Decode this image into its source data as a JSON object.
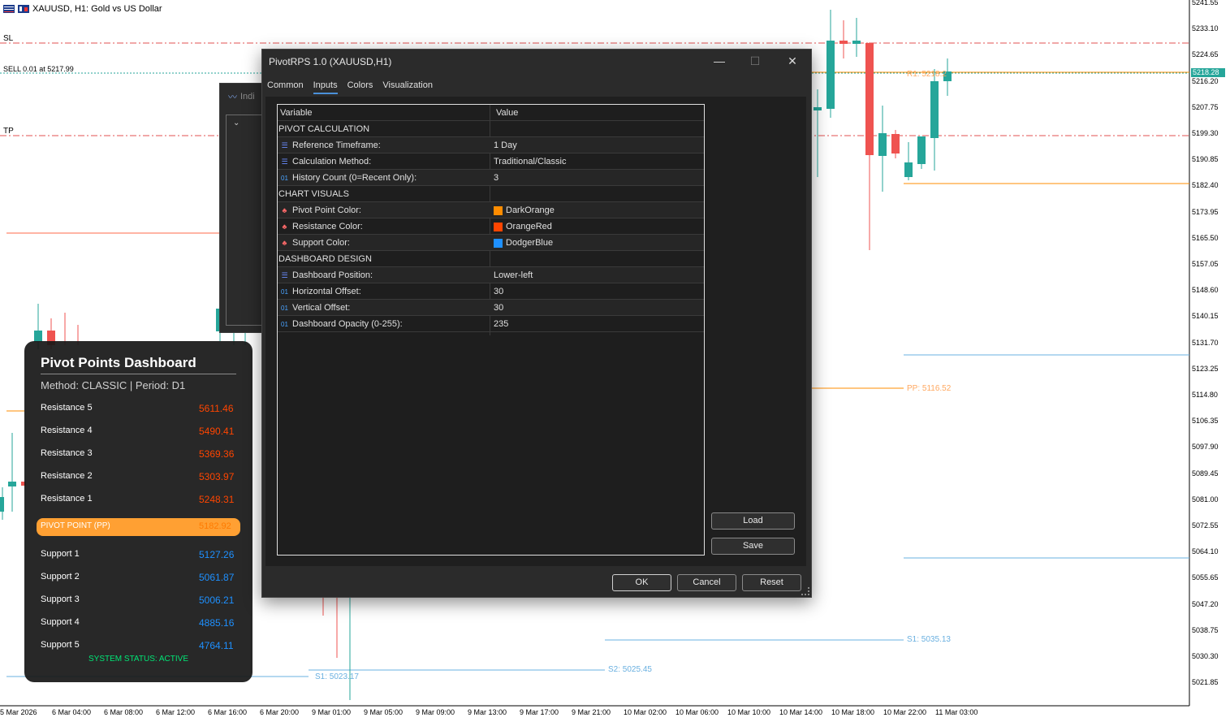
{
  "chart": {
    "symbol_title": "XAUUSD, H1:  Gold vs US Dollar",
    "lines": {
      "sl": "SL",
      "sell": "SELL 0.01 at 5217.99",
      "tp": "TP"
    },
    "current_price": "5218.28",
    "levels": {
      "r1": "R1: 5218.2",
      "pp": "PP: 5116.52",
      "s1_right": "S1: 5035.13",
      "s2": "S2: 5025.45",
      "s1_left": "S1: 5023.17"
    },
    "price_axis": [
      "5241.55",
      "5233.10",
      "5224.65",
      "5216.20",
      "5207.75",
      "5199.30",
      "5190.85",
      "5182.40",
      "5173.95",
      "5165.50",
      "5157.05",
      "5148.60",
      "5140.15",
      "5131.70",
      "5123.25",
      "5114.80",
      "5106.35",
      "5097.90",
      "5089.45",
      "5081.00",
      "5072.55",
      "5064.10",
      "5055.65",
      "5047.20",
      "5038.75",
      "5030.30",
      "5021.85"
    ],
    "time_axis": [
      "5 Mar 2026",
      "6 Mar 04:00",
      "6 Mar 08:00",
      "6 Mar 12:00",
      "6 Mar 16:00",
      "6 Mar 20:00",
      "9 Mar 01:00",
      "9 Mar 05:00",
      "9 Mar 09:00",
      "9 Mar 13:00",
      "9 Mar 17:00",
      "9 Mar 21:00",
      "10 Mar 02:00",
      "10 Mar 06:00",
      "10 Mar 10:00",
      "10 Mar 14:00",
      "10 Mar 18:00",
      "10 Mar 22:00",
      "11 Mar 03:00"
    ]
  },
  "behind_window": {
    "title": "Indi"
  },
  "dashboard": {
    "title": "Pivot Points Dashboard",
    "method": "Method: CLASSIC | Period: D1",
    "resistance": [
      {
        "label": "Resistance 5",
        "value": "5611.46"
      },
      {
        "label": "Resistance 4",
        "value": "5490.41"
      },
      {
        "label": "Resistance 3",
        "value": "5369.36"
      },
      {
        "label": "Resistance 2",
        "value": "5303.97"
      },
      {
        "label": "Resistance 1",
        "value": "5248.31"
      }
    ],
    "pivot": {
      "label": "PIVOT POINT (PP)",
      "value": "5182.92"
    },
    "support": [
      {
        "label": "Support 1",
        "value": "5127.26"
      },
      {
        "label": "Support 2",
        "value": "5061.87"
      },
      {
        "label": "Support 3",
        "value": "5006.21"
      },
      {
        "label": "Support 4",
        "value": "4885.16"
      },
      {
        "label": "Support 5",
        "value": "4764.11"
      }
    ],
    "status": "SYSTEM STATUS: ACTIVE"
  },
  "dialog": {
    "title": "PivotRPS 1.0 (XAUUSD,H1)",
    "tabs": [
      "Common",
      "Inputs",
      "Colors",
      "Visualization"
    ],
    "active_tab": "Inputs",
    "header": {
      "variable": "Variable",
      "value": "Value"
    },
    "rows": [
      {
        "kind": "section",
        "variable": "PIVOT CALCULATION",
        "value": ""
      },
      {
        "kind": "list",
        "icon": "list-icon",
        "variable": "Reference Timeframe:",
        "value": "1 Day"
      },
      {
        "kind": "list",
        "icon": "list-icon",
        "variable": "Calculation Method:",
        "value": "Traditional/Classic"
      },
      {
        "kind": "num",
        "icon": "number-icon",
        "variable": "History Count (0=Recent Only):",
        "value": "3"
      },
      {
        "kind": "section",
        "variable": "CHART VISUALS",
        "value": ""
      },
      {
        "kind": "color",
        "icon": "color-icon",
        "variable": "Pivot Point Color:",
        "value": "DarkOrange",
        "swatch": "#ff8c00"
      },
      {
        "kind": "color",
        "icon": "color-icon",
        "variable": "Resistance Color:",
        "value": "OrangeRed",
        "swatch": "#ff4500"
      },
      {
        "kind": "color",
        "icon": "color-icon",
        "variable": "Support Color:",
        "value": "DodgerBlue",
        "swatch": "#1e90ff"
      },
      {
        "kind": "section",
        "variable": "DASHBOARD DESIGN",
        "value": ""
      },
      {
        "kind": "list",
        "icon": "list-icon",
        "variable": "Dashboard Position:",
        "value": "Lower-left"
      },
      {
        "kind": "num",
        "icon": "number-icon",
        "variable": "Horizontal Offset:",
        "value": "30"
      },
      {
        "kind": "num",
        "icon": "number-icon",
        "variable": "Vertical Offset:",
        "value": "30"
      },
      {
        "kind": "num",
        "icon": "number-icon",
        "variable": "Dashboard Opacity (0-255):",
        "value": "235"
      }
    ],
    "buttons": {
      "load": "Load",
      "save": "Save",
      "ok": "OK",
      "cancel": "Cancel",
      "reset": "Reset"
    },
    "icon_glyphs": {
      "list": "☰",
      "num": "01",
      "color": "♣"
    }
  },
  "colors": {
    "bull": "#26a69a",
    "bear": "#ef5350",
    "resistance": "#ff4500",
    "support": "#1e90ff",
    "pivot": "#ff8c00"
  }
}
